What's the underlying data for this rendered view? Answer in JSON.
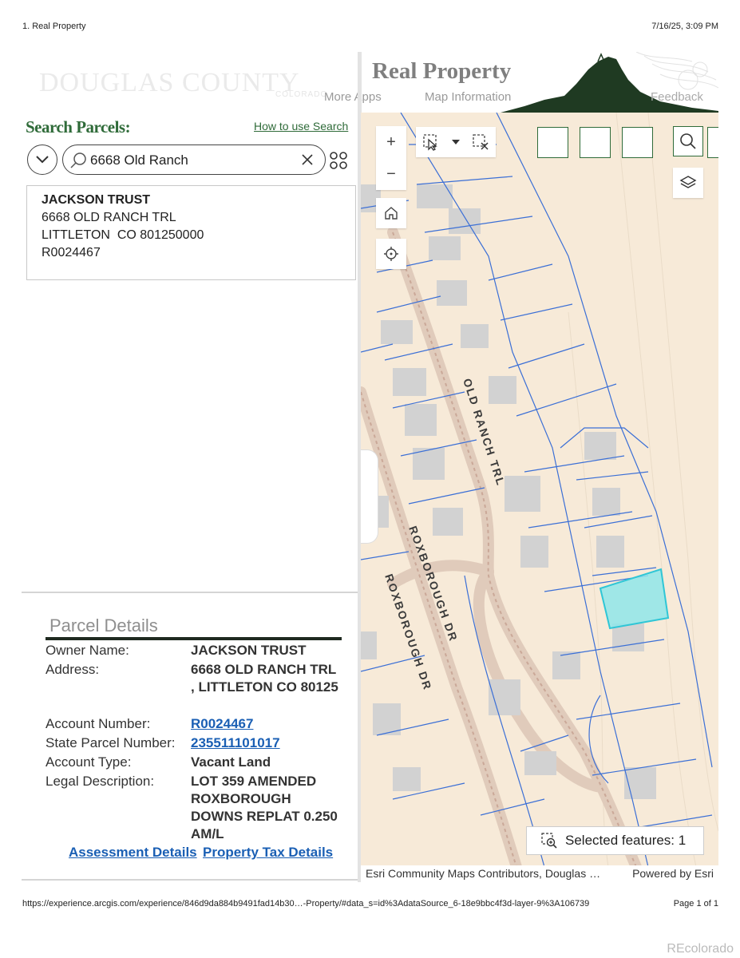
{
  "print": {
    "header_left": "1. Real Property",
    "header_right": "7/16/25, 3:09 PM",
    "footer_url": "https://experience.arcgis.com/experience/846d9da884b9491fad14b30…-Property/#data_s=id%3AdataSource_6-18e9bbc4f3d-layer-9%3A106739",
    "footer_page": "Page 1 of 1",
    "watermark": "REcolorado"
  },
  "banner": {
    "logo_text": "DOUGLAS COUNTY",
    "logo_sub": "COLORADO",
    "title": "Real Property",
    "nav": {
      "more_apps": "More Apps",
      "map_information": "Map Information",
      "feedback": "Feedback"
    }
  },
  "search": {
    "title": "Search Parcels:",
    "how_to": "How to use Search",
    "value": "6668 Old Ranch",
    "result": {
      "owner": "JACKSON TRUST",
      "address_line1": "6668 OLD RANCH TRL",
      "address_line2": "LITTLETON  CO 801250000",
      "account": "R0024467"
    }
  },
  "details": {
    "title": "Parcel Details",
    "labels": {
      "owner": "Owner Name:",
      "address": "Address:",
      "account_number": "Account Number:",
      "state_parcel": "State Parcel Number:",
      "account_type": "Account Type:",
      "legal": "Legal Description:"
    },
    "values": {
      "owner": "JACKSON TRUST",
      "address": "6668 OLD RANCH TRL , LITTLETON CO 80125",
      "account_number": "R0024467",
      "state_parcel": "235511101017",
      "account_type": "Vacant Land",
      "legal": "LOT 359 AMENDED ROXBOROUGH DOWNS REPLAT 0.250 AM/L"
    },
    "links": {
      "assessment": "Assessment Details",
      "property_tax": "Property Tax Details"
    }
  },
  "map": {
    "streets": {
      "old_ranch": "OLD RANCH TRL",
      "roxborough_1": "ROXBOROUGH DR",
      "roxborough_2": "ROXBOROUGH DR"
    },
    "selected_features": "Selected features: 1",
    "attribution": "Esri Community Maps Contributors, Douglas …",
    "powered_by": "Powered by Esri",
    "colors": {
      "background": "#f7ead8",
      "parcel_line": "#3b6fd6",
      "selected_fill": "#8fe6ea",
      "selected_stroke": "#2fc6d6",
      "road": "#d8c3b3"
    }
  },
  "icons": [
    "chevron-down-icon",
    "search-icon",
    "close-icon",
    "grid-icon",
    "plus-icon",
    "minus-icon",
    "home-icon",
    "locate-icon",
    "select-cursor-icon",
    "caret-down-icon",
    "clear-selection-icon",
    "layers-icon",
    "zoom-to-selection-icon"
  ]
}
